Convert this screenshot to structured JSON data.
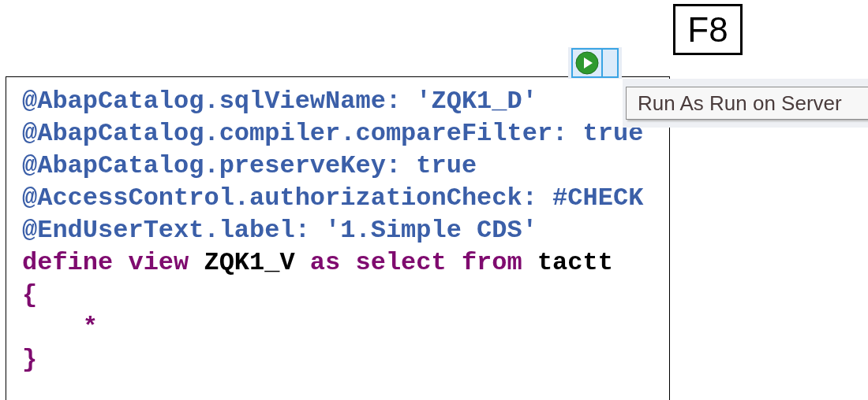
{
  "key_label": "F8",
  "tooltip": "Run As Run on Server",
  "code_lines": [
    [
      {
        "text": "@AbapCatalog.sqlViewName: 'ZQK1_D'",
        "kind": "annotation"
      }
    ],
    [
      {
        "text": "@AbapCatalog.compiler.compareFilter: true",
        "kind": "annotation"
      }
    ],
    [
      {
        "text": "@AbapCatalog.preserveKey: true",
        "kind": "annotation"
      }
    ],
    [
      {
        "text": "@AccessControl.authorizationCheck: #CHECK",
        "kind": "annotation"
      }
    ],
    [
      {
        "text": "@EndUserText.label: '1.Simple CDS'",
        "kind": "annotation"
      }
    ],
    [
      {
        "text": "define view",
        "kind": "keyword"
      },
      {
        "text": " ZQK1_V ",
        "kind": "identifier"
      },
      {
        "text": "as select from",
        "kind": "keyword"
      },
      {
        "text": " tactt",
        "kind": "identifier"
      }
    ],
    [
      {
        "text": "{",
        "kind": "keyword"
      }
    ],
    [
      {
        "text": "    *",
        "kind": "keyword"
      }
    ],
    [
      {
        "text": "}",
        "kind": "keyword"
      }
    ]
  ]
}
